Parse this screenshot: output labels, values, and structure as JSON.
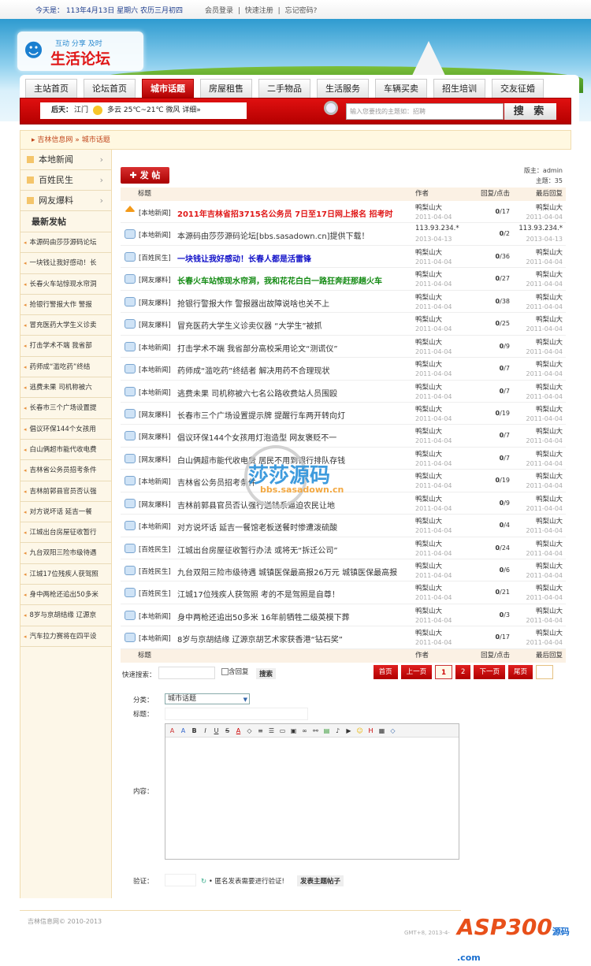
{
  "topbar": {
    "date": "今天是： 113年4月13日 星期六 农历三月初四",
    "login": "会员登录",
    "register": "快速注册",
    "forgot": "忘记密码?",
    "sep": "|"
  },
  "logo": {
    "slogan": "互动 分享 及时",
    "name": "生活论坛"
  },
  "nav": [
    "主站首页",
    "论坛首页",
    "城市话题",
    "房屋租售",
    "二手物品",
    "生活服务",
    "车辆买卖",
    "招生培训",
    "交友征婚"
  ],
  "weather": {
    "label": "后天：",
    "city": "江门",
    "info": "多云 25℃~21℃ 微风 详细»"
  },
  "search": {
    "placeholder": "输入您要找的主题如：招聘",
    "button": "搜 索"
  },
  "breadcrumb": {
    "home": "吉林信息网",
    "sep": "»",
    "current": "城市话题"
  },
  "sidebar": {
    "cats": [
      "本地新闻",
      "百姓民生",
      "网友爆料"
    ],
    "latest_title": "最新发帖",
    "latest": [
      "本源码由莎莎源码论坛",
      "一块钱让我好感动！长",
      "长春火车站惊现水帘洞",
      "抢银行警报大作 警报",
      "冒充医药大学生义诊卖",
      "打击学术不端 我省部",
      "药师成“滥吃药”终结",
      "逃费未果 司机称被六",
      "长春市三个广场设置提",
      "倡议环保144个女孩用",
      "白山俩超市能代收电费",
      "吉林省公务员招考条件",
      "吉林前郭县官员否认强",
      "对方说坏话 延吉一餐",
      "江城出台房屋征收暂行",
      "九台双阳三险市级待遇",
      "江城17位残疾人获驾照",
      "身中两枪还追出50多米",
      "8岁与京胡结缘 辽源京",
      "汽车拉力赛将在四平设"
    ]
  },
  "post_button": "✚ 发 帖",
  "moderator": "版主：admin",
  "topics": "主题：35",
  "table": {
    "headers": {
      "title": "标题",
      "author": "作者",
      "stats": "回复/点击",
      "last": "最后回复"
    },
    "rows": [
      {
        "tag": "[本地新闻]",
        "title": "2011年吉林省招3715名公务员 7日至17日网上报名 招考时",
        "style": "red",
        "pin": true,
        "author": "鸭梨山大",
        "date": "2011-04-04",
        "replies": "0",
        "views": "/17",
        "last": "鸭梨山大",
        "last_date": "2011-04-04"
      },
      {
        "tag": "[本地新闻]",
        "title": "本源码由莎莎源码论坛[bbs.sasadown.cn]提供下载！",
        "style": "",
        "author": "113.93.234.*",
        "date": "2013-04-13",
        "replies": "0",
        "views": "/2",
        "last": "113.93.234.*",
        "last_date": "2013-04-13"
      },
      {
        "tag": "[百姓民生]",
        "title": "一块钱让我好感动！长春人都是活雷锋",
        "style": "blue",
        "author": "鸭梨山大",
        "date": "2011-04-04",
        "replies": "0",
        "views": "/36",
        "last": "鸭梨山大",
        "last_date": "2011-04-04"
      },
      {
        "tag": "[网友爆料]",
        "title": "长春火车站惊现水帘洞，我和花花白白一路狂奔赶那趟火车",
        "style": "green",
        "author": "鸭梨山大",
        "date": "2011-04-04",
        "replies": "0",
        "views": "/27",
        "last": "鸭梨山大",
        "last_date": "2011-04-04"
      },
      {
        "tag": "[网友爆料]",
        "title": "抢银行警报大作 警报器出故障说啥也关不上",
        "style": "",
        "author": "鸭梨山大",
        "date": "2011-04-04",
        "replies": "0",
        "views": "/38",
        "last": "鸭梨山大",
        "last_date": "2011-04-04"
      },
      {
        "tag": "[网友爆料]",
        "title": "冒充医药大学生义诊卖仪器 “大学生”被抓",
        "style": "",
        "author": "鸭梨山大",
        "date": "2011-04-04",
        "replies": "0",
        "views": "/25",
        "last": "鸭梨山大",
        "last_date": "2011-04-04"
      },
      {
        "tag": "[本地新闻]",
        "title": "打击学术不端 我省部分高校采用论文“测谎仪”",
        "style": "",
        "author": "鸭梨山大",
        "date": "2011-04-04",
        "replies": "0",
        "views": "/9",
        "last": "鸭梨山大",
        "last_date": "2011-04-04"
      },
      {
        "tag": "[本地新闻]",
        "title": "药师成“滥吃药”终结者 解决用药不合理现状",
        "style": "",
        "author": "鸭梨山大",
        "date": "2011-04-04",
        "replies": "0",
        "views": "/7",
        "last": "鸭梨山大",
        "last_date": "2011-04-04"
      },
      {
        "tag": "[本地新闻]",
        "title": "逃费未果 司机称被六七名公路收费站人员围殴",
        "style": "",
        "author": "鸭梨山大",
        "date": "2011-04-04",
        "replies": "0",
        "views": "/7",
        "last": "鸭梨山大",
        "last_date": "2011-04-04"
      },
      {
        "tag": "[网友爆料]",
        "title": "长春市三个广场设置提示牌 提醒行车两开转向灯",
        "style": "",
        "author": "鸭梨山大",
        "date": "2011-04-04",
        "replies": "0",
        "views": "/19",
        "last": "鸭梨山大",
        "last_date": "2011-04-04"
      },
      {
        "tag": "[网友爆料]",
        "title": "倡议环保144个女孩用灯泡造型 网友褒贬不一",
        "style": "",
        "author": "鸭梨山大",
        "date": "2011-04-04",
        "replies": "0",
        "views": "/7",
        "last": "鸭梨山大",
        "last_date": "2011-04-04"
      },
      {
        "tag": "[网友爆料]",
        "title": "白山俩超市能代收电费 居民不用到银行排队存钱",
        "style": "",
        "author": "鸭梨山大",
        "date": "2011-04-04",
        "replies": "0",
        "views": "/7",
        "last": "鸭梨山大",
        "last_date": "2011-04-04"
      },
      {
        "tag": "[本地新闻]",
        "title": "吉林省公务员招考条件",
        "style": "",
        "author": "鸭梨山大",
        "date": "2011-04-04",
        "replies": "0",
        "views": "/19",
        "last": "鸭梨山大",
        "last_date": "2011-04-04"
      },
      {
        "tag": "[网友爆料]",
        "title": "吉林前郭县官员否认强行送钱系逼迫农民让地",
        "style": "",
        "author": "鸭梨山大",
        "date": "2011-04-04",
        "replies": "0",
        "views": "/9",
        "last": "鸭梨山大",
        "last_date": "2011-04-04"
      },
      {
        "tag": "[本地新闻]",
        "title": "对方说坏话 延吉一餐馆老板送餐时惨遭泼硫酸",
        "style": "",
        "author": "鸭梨山大",
        "date": "2011-04-04",
        "replies": "0",
        "views": "/4",
        "last": "鸭梨山大",
        "last_date": "2011-04-04"
      },
      {
        "tag": "[百姓民生]",
        "title": "江城出台房屋征收暂行办法 或将无“拆迁公司”",
        "style": "",
        "author": "鸭梨山大",
        "date": "2011-04-04",
        "replies": "0",
        "views": "/24",
        "last": "鸭梨山大",
        "last_date": "2011-04-04"
      },
      {
        "tag": "[百姓民生]",
        "title": "九台双阳三险市级待遇 城镇医保最高报26万元 城镇医保最高报",
        "style": "",
        "author": "鸭梨山大",
        "date": "2011-04-04",
        "replies": "0",
        "views": "/6",
        "last": "鸭梨山大",
        "last_date": "2011-04-04"
      },
      {
        "tag": "[百姓民生]",
        "title": "江城17位残疾人获驾照 考的不是驾照是自尊！",
        "style": "",
        "author": "鸭梨山大",
        "date": "2011-04-04",
        "replies": "0",
        "views": "/21",
        "last": "鸭梨山大",
        "last_date": "2011-04-04"
      },
      {
        "tag": "[本地新闻]",
        "title": "身中两枪还追出50多米 16年前牺牲二级英模下葬",
        "style": "",
        "author": "鸭梨山大",
        "date": "2011-04-04",
        "replies": "0",
        "views": "/3",
        "last": "鸭梨山大",
        "last_date": "2011-04-04"
      },
      {
        "tag": "[本地新闻]",
        "title": "8岁与京胡结缘 辽源京胡艺术家获香港“钻石奖”",
        "style": "",
        "author": "鸭梨山大",
        "date": "2011-04-04",
        "replies": "0",
        "views": "/17",
        "last": "鸭梨山大",
        "last_date": "2011-04-04"
      }
    ]
  },
  "pager": {
    "quick_search": "快速搜索：",
    "include_replies": "含回复",
    "search_btn": "搜索",
    "first": "首页",
    "prev": "上一页",
    "pages": [
      "1",
      "2"
    ],
    "next": "下一页",
    "last": "尾页"
  },
  "form": {
    "category_label": "分类：",
    "category_value": "城市话题",
    "title_label": "标题：",
    "content_label": "内容：",
    "verify_label": "验证：",
    "verify_hint": "• 匿名发表需要进行验证!",
    "submit": "发表主题帖子"
  },
  "footer": {
    "copyright": "吉林信息网© 2010-2013",
    "gmt": "GMT+8, 2013-4-"
  },
  "watermark": {
    "name": "莎莎源码",
    "url": "bbs.sasadown.cn"
  },
  "asp_logo": {
    "name": "ASP300",
    "sub": "源码 .com"
  },
  "colors": {
    "accent": "#c80000",
    "sidebar_bg": "#fdf7e8"
  }
}
